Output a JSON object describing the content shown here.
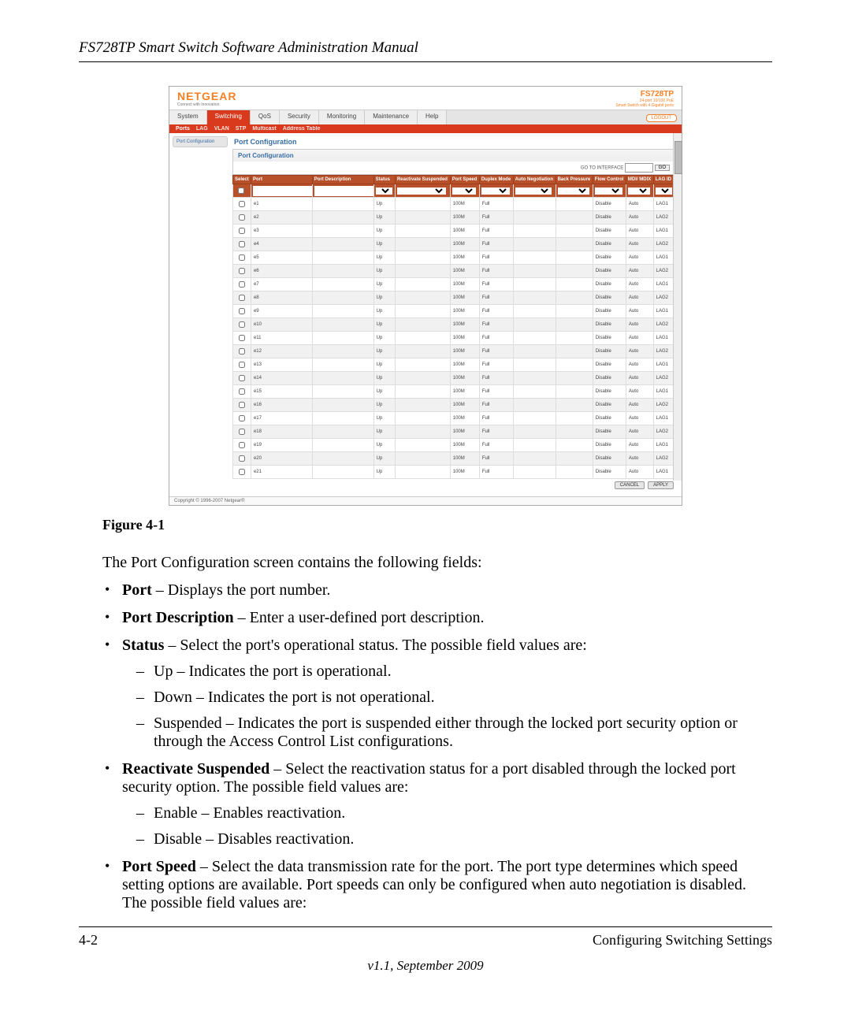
{
  "doc": {
    "header_title": "FS728TP Smart Switch Software Administration Manual",
    "figure_caption": "Figure 4-1",
    "intro": "The Port Configuration screen contains the following fields:",
    "bullets": [
      {
        "term": "Port",
        "text": " – Displays the port number."
      },
      {
        "term": "Port Description",
        "text": " – Enter a user-defined port description."
      },
      {
        "term": "Status",
        "text": " – Select the port's operational status. The possible field values are:",
        "sub": [
          "Up – Indicates the port is operational.",
          "Down – Indicates the port is not operational.",
          "Suspended – Indicates the port is suspended either through the locked port security option or through the Access Control List configurations."
        ]
      },
      {
        "term": "Reactivate Suspended",
        "text": " – Select the reactivation status for a port disabled through the locked port security option. The possible field values are:",
        "sub": [
          "Enable – Enables reactivation.",
          "Disable – Disables reactivation."
        ]
      },
      {
        "term": "Port Speed",
        "text": " – Select the data transmission rate for the port. The port type determines which speed setting options are available. Port speeds can only be configured when auto negotiation is disabled. The possible field values are:"
      }
    ],
    "page_num": "4-2",
    "page_section": "Configuring Switching Settings",
    "version": "v1.1, September 2009"
  },
  "ui": {
    "brand": "NETGEAR",
    "brand_tag": "Connect with Innovation",
    "product": "FS728TP",
    "product_sub1": "24-port 10/100 PoE",
    "product_sub2": "Smart Switch with 4 Gigabit ports",
    "logout": "LOGOUT",
    "main_tabs": [
      "System",
      "Switching",
      "QoS",
      "Security",
      "Monitoring",
      "Maintenance",
      "Help"
    ],
    "main_active": "Switching",
    "sub_tabs": [
      "Ports",
      "LAG",
      "VLAN",
      "STP",
      "Multicast",
      "Address Table"
    ],
    "sub_active": "Ports",
    "side_item": "Port Configuration",
    "panel_title": "Port Configuration",
    "panel_sub": "Port Configuration",
    "goto_label": "GO TO INTERFACE",
    "go_btn": "GO",
    "columns": [
      "Select",
      "Port",
      "Port Description",
      "Status",
      "Reactivate Suspended",
      "Port Speed",
      "Duplex Mode",
      "Auto Negotiation",
      "Back Pressure",
      "Flow Control",
      "MDI/ MDIX",
      "LAG ID"
    ],
    "rows": [
      {
        "port": "e1",
        "status": "Up",
        "speed": "100M",
        "duplex": "Full",
        "flow": "Disable",
        "mdi": "Auto",
        "lag": "LAG1"
      },
      {
        "port": "e2",
        "status": "Up",
        "speed": "100M",
        "duplex": "Full",
        "flow": "Disable",
        "mdi": "Auto",
        "lag": "LAG2"
      },
      {
        "port": "e3",
        "status": "Up",
        "speed": "100M",
        "duplex": "Full",
        "flow": "Disable",
        "mdi": "Auto",
        "lag": "LAG1"
      },
      {
        "port": "e4",
        "status": "Up",
        "speed": "100M",
        "duplex": "Full",
        "flow": "Disable",
        "mdi": "Auto",
        "lag": "LAG2"
      },
      {
        "port": "e5",
        "status": "Up",
        "speed": "100M",
        "duplex": "Full",
        "flow": "Disable",
        "mdi": "Auto",
        "lag": "LAG1"
      },
      {
        "port": "e6",
        "status": "Up",
        "speed": "100M",
        "duplex": "Full",
        "flow": "Disable",
        "mdi": "Auto",
        "lag": "LAG2"
      },
      {
        "port": "e7",
        "status": "Up",
        "speed": "100M",
        "duplex": "Full",
        "flow": "Disable",
        "mdi": "Auto",
        "lag": "LAG1"
      },
      {
        "port": "e8",
        "status": "Up",
        "speed": "100M",
        "duplex": "Full",
        "flow": "Disable",
        "mdi": "Auto",
        "lag": "LAG2"
      },
      {
        "port": "e9",
        "status": "Up",
        "speed": "100M",
        "duplex": "Full",
        "flow": "Disable",
        "mdi": "Auto",
        "lag": "LAG1"
      },
      {
        "port": "e10",
        "status": "Up",
        "speed": "100M",
        "duplex": "Full",
        "flow": "Disable",
        "mdi": "Auto",
        "lag": "LAG2"
      },
      {
        "port": "e11",
        "status": "Up",
        "speed": "100M",
        "duplex": "Full",
        "flow": "Disable",
        "mdi": "Auto",
        "lag": "LAG1"
      },
      {
        "port": "e12",
        "status": "Up",
        "speed": "100M",
        "duplex": "Full",
        "flow": "Disable",
        "mdi": "Auto",
        "lag": "LAG2"
      },
      {
        "port": "e13",
        "status": "Up",
        "speed": "100M",
        "duplex": "Full",
        "flow": "Disable",
        "mdi": "Auto",
        "lag": "LAG1"
      },
      {
        "port": "e14",
        "status": "Up",
        "speed": "100M",
        "duplex": "Full",
        "flow": "Disable",
        "mdi": "Auto",
        "lag": "LAG2"
      },
      {
        "port": "e15",
        "status": "Up",
        "speed": "100M",
        "duplex": "Full",
        "flow": "Disable",
        "mdi": "Auto",
        "lag": "LAG1"
      },
      {
        "port": "e16",
        "status": "Up",
        "speed": "100M",
        "duplex": "Full",
        "flow": "Disable",
        "mdi": "Auto",
        "lag": "LAG2"
      },
      {
        "port": "e17",
        "status": "Up",
        "speed": "100M",
        "duplex": "Full",
        "flow": "Disable",
        "mdi": "Auto",
        "lag": "LAG1"
      },
      {
        "port": "e18",
        "status": "Up",
        "speed": "100M",
        "duplex": "Full",
        "flow": "Disable",
        "mdi": "Auto",
        "lag": "LAG2"
      },
      {
        "port": "e19",
        "status": "Up",
        "speed": "100M",
        "duplex": "Full",
        "flow": "Disable",
        "mdi": "Auto",
        "lag": "LAG1"
      },
      {
        "port": "e20",
        "status": "Up",
        "speed": "100M",
        "duplex": "Full",
        "flow": "Disable",
        "mdi": "Auto",
        "lag": "LAG2"
      },
      {
        "port": "e21",
        "status": "Up",
        "speed": "100M",
        "duplex": "Full",
        "flow": "Disable",
        "mdi": "Auto",
        "lag": "LAG1"
      }
    ],
    "cancel": "CANCEL",
    "apply": "APPLY",
    "copyright": "Copyright © 1996-2007 Netgear®"
  }
}
